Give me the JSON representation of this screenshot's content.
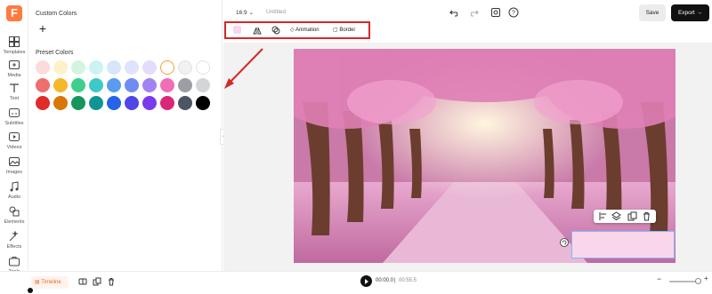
{
  "rail": {
    "items": [
      {
        "label": "Templates",
        "icon": "templates-icon"
      },
      {
        "label": "Media",
        "icon": "media-icon"
      },
      {
        "label": "Text",
        "icon": "text-icon"
      },
      {
        "label": "Subtitles",
        "icon": "subtitles-icon"
      },
      {
        "label": "Videos",
        "icon": "videos-icon"
      },
      {
        "label": "Images",
        "icon": "images-icon"
      },
      {
        "label": "Audio",
        "icon": "audio-icon"
      },
      {
        "label": "Elements",
        "icon": "elements-icon"
      },
      {
        "label": "Effects",
        "icon": "effects-icon"
      },
      {
        "label": "Tools",
        "icon": "tools-icon"
      }
    ]
  },
  "panel": {
    "custom_title": "Custom Colors",
    "add_label": "+",
    "preset_title": "Preset Colors",
    "preset_rows": [
      [
        "#fddbdb",
        "#fdf1c9",
        "#d3f5df",
        "#ccf2f2",
        "#d7e6fb",
        "#dfe3fd",
        "#e4dcfb",
        "#ffffff",
        "#f1f1f1",
        "#ffffff"
      ],
      [
        "#ef6e6e",
        "#f5b82a",
        "#3ecf8e",
        "#3cc9c9",
        "#5a9bef",
        "#6f8cf3",
        "#a283f3",
        "#ef6fb4",
        "#9b9ea3",
        "#d3d5d8"
      ],
      [
        "#e12a2a",
        "#d97706",
        "#16955c",
        "#0f9595",
        "#2563eb",
        "#4f46e5",
        "#7c3aed",
        "#db2777",
        "#4b5563",
        "#000000"
      ]
    ]
  },
  "topbar": {
    "ratio": "16:9",
    "title": "Untitled",
    "save": "Save",
    "export": "Export"
  },
  "toolbar": {
    "animation": "Animation",
    "border": "Border"
  },
  "timeline": {
    "label": "Timeline",
    "current_time": "00:00.0",
    "total_time": "00:55.5"
  },
  "colors": {
    "accent": "#ff7a3d",
    "highlight_frame": "#d62828"
  }
}
